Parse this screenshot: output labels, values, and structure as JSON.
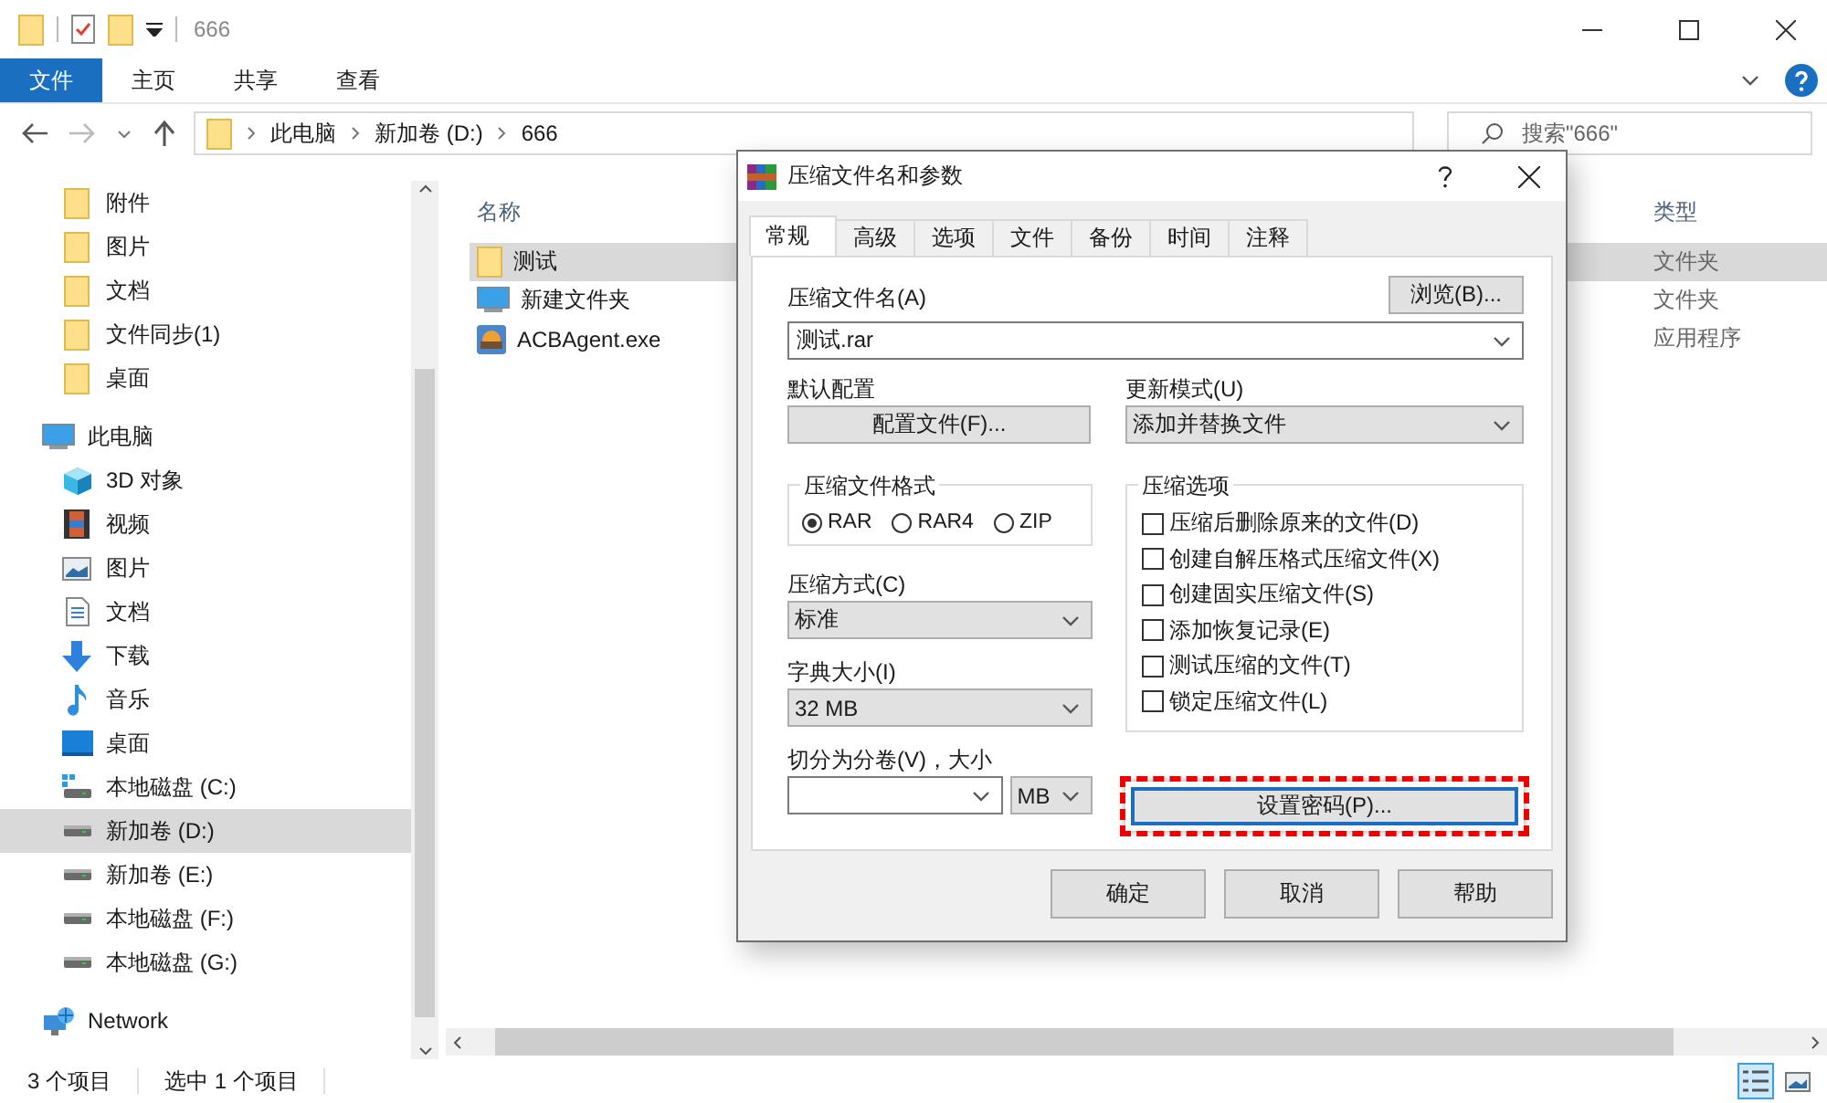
{
  "window": {
    "title": "666"
  },
  "ribbon_tabs": [
    {
      "label": "文件",
      "selected": true
    },
    {
      "label": "主页",
      "selected": false
    },
    {
      "label": "共享",
      "selected": false
    },
    {
      "label": "查看",
      "selected": false
    }
  ],
  "address": {
    "path": [
      "此电脑",
      "新加卷 (D:)",
      "666"
    ]
  },
  "search": {
    "placeholder": "搜索\"666\""
  },
  "sidebar": {
    "quick_access": [
      {
        "label": "附件",
        "kind": "folder",
        "selected": false
      },
      {
        "label": "图片",
        "kind": "folder",
        "selected": false
      },
      {
        "label": "文档",
        "kind": "folder",
        "selected": false
      },
      {
        "label": "文件同步(1)",
        "kind": "folder",
        "selected": false
      },
      {
        "label": "桌面",
        "kind": "folder",
        "selected": false
      }
    ],
    "tree": [
      {
        "label": "此电脑",
        "kind": "pc",
        "selected": false,
        "children": [
          {
            "label": "3D 对象",
            "kind": "cube",
            "selected": false
          },
          {
            "label": "视频",
            "kind": "video",
            "selected": false
          },
          {
            "label": "图片",
            "kind": "picture",
            "selected": false
          },
          {
            "label": "文档",
            "kind": "doc",
            "selected": false
          },
          {
            "label": "下载",
            "kind": "download",
            "selected": false
          },
          {
            "label": "音乐",
            "kind": "music",
            "selected": false
          },
          {
            "label": "桌面",
            "kind": "desktop",
            "selected": false
          },
          {
            "label": "本地磁盘 (C:)",
            "kind": "system-drive",
            "selected": false
          },
          {
            "label": "新加卷 (D:)",
            "kind": "drive",
            "selected": true
          },
          {
            "label": "新加卷 (E:)",
            "kind": "drive",
            "selected": false
          },
          {
            "label": "本地磁盘 (F:)",
            "kind": "drive",
            "selected": false
          },
          {
            "label": "本地磁盘 (G:)",
            "kind": "drive",
            "selected": false
          }
        ]
      },
      {
        "label": "Network",
        "kind": "network",
        "selected": false
      }
    ]
  },
  "file_list": {
    "columns": [
      "名称",
      "类型"
    ],
    "rows": [
      {
        "name": "测试",
        "type": "文件夹",
        "kind": "folder",
        "selected": true
      },
      {
        "name": "新建文件夹",
        "kind": "pc",
        "type": "文件夹",
        "selected": false
      },
      {
        "name": "ACBAgent.exe",
        "kind": "app",
        "type": "应用程序",
        "selected": false
      }
    ]
  },
  "status_bar": {
    "item_count": "3 个项目",
    "selection": "选中 1 个项目"
  },
  "dialog": {
    "title": "压缩文件名和参数",
    "tabs": [
      {
        "label": "常规",
        "selected": true
      },
      {
        "label": "高级",
        "selected": false
      },
      {
        "label": "选项",
        "selected": false
      },
      {
        "label": "文件",
        "selected": false
      },
      {
        "label": "备份",
        "selected": false
      },
      {
        "label": "时间",
        "selected": false
      },
      {
        "label": "注释",
        "selected": false
      }
    ],
    "archive_name": {
      "label": "压缩文件名(A)",
      "value": "测试.rar",
      "browse": "浏览(B)..."
    },
    "default_profile": {
      "label": "默认配置",
      "button": "配置文件(F)..."
    },
    "update_mode": {
      "label": "更新模式(U)",
      "value": "添加并替换文件"
    },
    "format": {
      "title": "压缩文件格式",
      "options": [
        {
          "label": "RAR",
          "selected": true
        },
        {
          "label": "RAR4",
          "selected": false
        },
        {
          "label": "ZIP",
          "selected": false
        }
      ]
    },
    "method": {
      "label": "压缩方式(C)",
      "value": "标准"
    },
    "dictionary": {
      "label": "字典大小(I)",
      "value": "32 MB"
    },
    "split": {
      "label": "切分为分卷(V)，大小",
      "unit": "MB"
    },
    "options": {
      "title": "压缩选项",
      "items": [
        {
          "label": "压缩后删除原来的文件(D)",
          "checked": false
        },
        {
          "label": "创建自解压格式压缩文件(X)",
          "checked": false
        },
        {
          "label": "创建固实压缩文件(S)",
          "checked": false
        },
        {
          "label": "添加恢复记录(E)",
          "checked": false
        },
        {
          "label": "测试压缩的文件(T)",
          "checked": false
        },
        {
          "label": "锁定压缩文件(L)",
          "checked": false
        }
      ]
    },
    "password": {
      "label": "设置密码(P)...",
      "highlighted": true
    },
    "buttons": [
      "确定",
      "取消",
      "帮助"
    ]
  }
}
